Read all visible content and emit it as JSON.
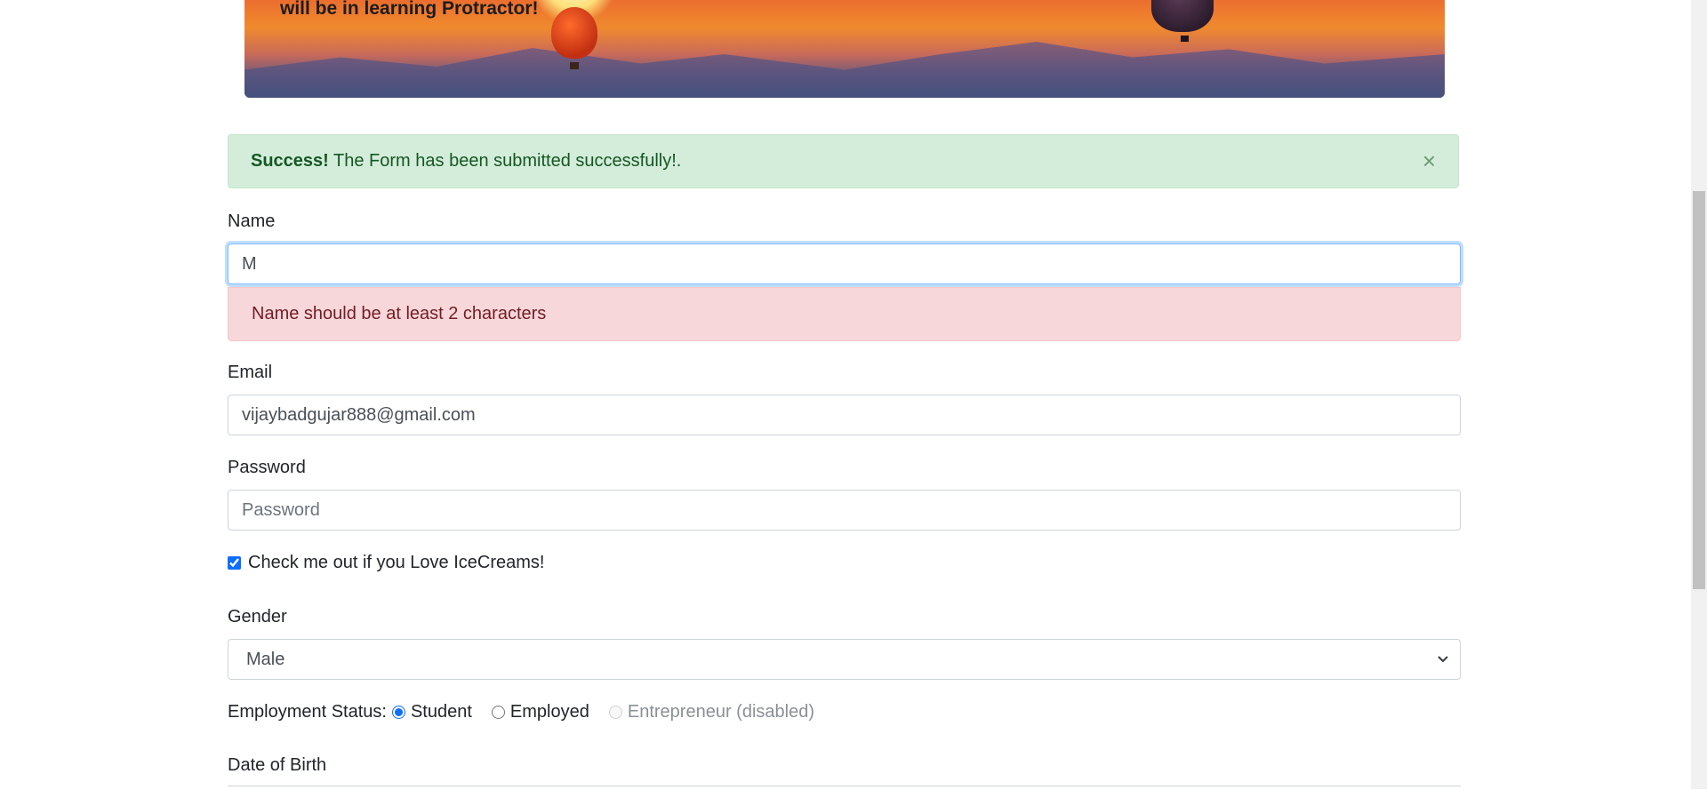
{
  "banner": {
    "text": "will be in learning Protractor!"
  },
  "success_alert": {
    "strong": "Success!",
    "message": " The Form has been submitted successfully!.",
    "close_symbol": "×"
  },
  "form": {
    "name": {
      "label": "Name",
      "value": "M",
      "error": "Name should be at least 2 characters"
    },
    "email": {
      "label": "Email",
      "value": "vijaybadgujar888@gmail.com"
    },
    "password": {
      "label": "Password",
      "placeholder": "Password"
    },
    "icecream": {
      "label": "Check me out if you Love IceCreams!",
      "checked": true
    },
    "gender": {
      "label": "Gender",
      "selected": "Male"
    },
    "employment": {
      "label": "Employment Status:",
      "options": [
        {
          "label": "Student",
          "checked": true,
          "disabled": false
        },
        {
          "label": "Employed",
          "checked": false,
          "disabled": false
        },
        {
          "label": "Entrepreneur (disabled)",
          "checked": false,
          "disabled": true
        }
      ]
    },
    "dob": {
      "label": "Date of Birth"
    }
  }
}
